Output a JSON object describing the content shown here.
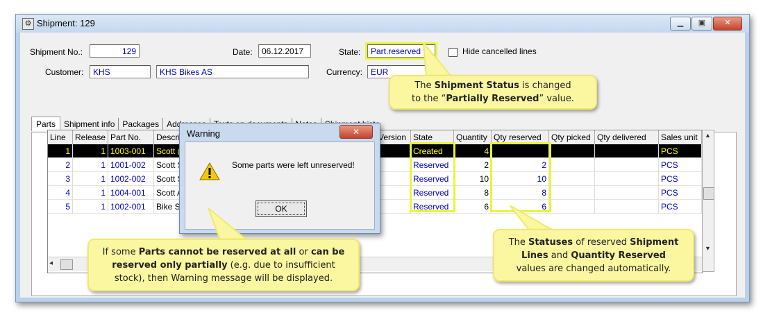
{
  "window": {
    "title": "Shipment: 129",
    "controls": [
      "▁",
      "▣",
      "✕"
    ]
  },
  "header": {
    "shipment_no_label": "Shipment No.:",
    "shipment_no": "129",
    "date_label": "Date:",
    "date": "06.12.2017",
    "state_label": "State:",
    "state": "Part.reserved",
    "hide_cancelled_label": "Hide cancelled lines",
    "customer_label": "Customer:",
    "customer_code": "KHS",
    "customer_name": "KHS Bikes AS",
    "currency_label": "Currency:",
    "currency": "EUR"
  },
  "tabs": [
    "Parts",
    "Shipment info",
    "Packages",
    "Addresses",
    "Texts on documents",
    "Notes",
    "Shipment histo"
  ],
  "grid": {
    "columns": [
      "Line",
      "Release",
      "Part No.",
      "Descri",
      "Version",
      "State",
      "Quantity",
      "Qty reserved",
      "Qty picked",
      "Qty delivered",
      "Sales unit"
    ],
    "rows": [
      {
        "line": "1",
        "release": "1",
        "part": "1003-001",
        "desc": "Scott (",
        "state": "Created",
        "qty": "4",
        "qty_reserved": "",
        "unit": "PCS"
      },
      {
        "line": "2",
        "release": "1",
        "part": "1001-002",
        "desc": "Scott S",
        "state": "Reserved",
        "qty": "2",
        "qty_reserved": "2",
        "unit": "PCS"
      },
      {
        "line": "3",
        "release": "1",
        "part": "1002-002",
        "desc": "Scott S",
        "state": "Reserved",
        "qty": "10",
        "qty_reserved": "10",
        "unit": "PCS"
      },
      {
        "line": "4",
        "release": "1",
        "part": "1004-001",
        "desc": "Scott A",
        "state": "Reserved",
        "qty": "8",
        "qty_reserved": "8",
        "unit": "PCS"
      },
      {
        "line": "5",
        "release": "1",
        "part": "1002-001",
        "desc": "Bike S",
        "state": "Reserved",
        "qty": "6",
        "qty_reserved": "6",
        "unit": "PCS"
      }
    ]
  },
  "dialog": {
    "title": "Warning",
    "message": "Some parts were left unreserved!",
    "ok_label": "OK"
  },
  "callouts": {
    "status": {
      "line1_a": "The ",
      "line1_b": "Shipment Status",
      "line1_c": " is changed",
      "line2_a": "to the “",
      "line2_b": "Partially Reserved",
      "line2_c": "” value."
    },
    "warning": {
      "l1_a": "If some ",
      "l1_b": "Parts cannot be reserved at all",
      "l1_c": " or ",
      "l1_d": "can be",
      "l2_a": "reserved only partially",
      "l2_b": " (e.g. due to insufficient",
      "l3": "stock), then Warning message will be displayed."
    },
    "lines": {
      "l1_a": "The ",
      "l1_b": "Statuses",
      "l1_c": " of reserved ",
      "l1_d": "Shipment",
      "l2_a": "Lines",
      "l2_b": " and ",
      "l2_c": "Quantity Reserved",
      "l3": "values are changed automatically."
    }
  },
  "colors": {
    "highlight": "#e9f53a",
    "callout_bg": "#fbf7a0",
    "value_text": "#0000c8",
    "selected_row_bg": "#000000",
    "selected_row_text": "#ffff00"
  }
}
